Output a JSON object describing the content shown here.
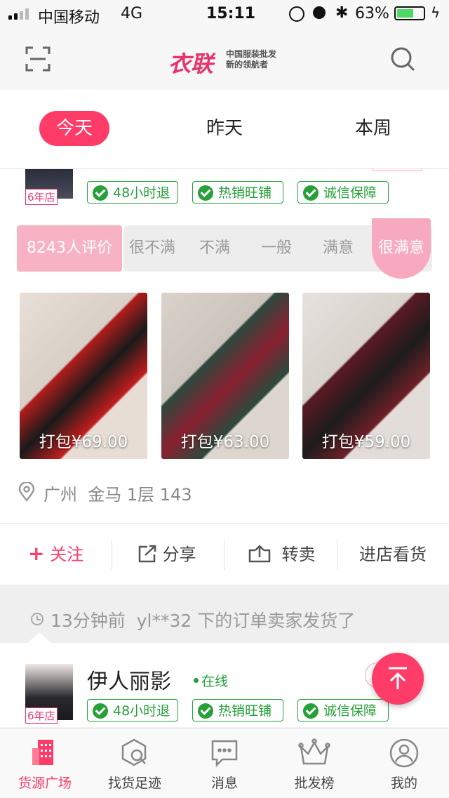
{
  "status_bar": {
    "carrier": "中国移动",
    "network": "4G",
    "time": "15:11",
    "battery": "63%",
    "battery_level": 0.63
  },
  "header": {
    "logo_main": "衣联",
    "logo_sub_line1": "中国服装批发",
    "logo_sub_line2": "新的领航者"
  },
  "tabs": [
    {
      "label": "今天",
      "active": true
    },
    {
      "label": "昨天",
      "active": false
    },
    {
      "label": "本周",
      "active": false
    }
  ],
  "shop1": {
    "years": "6年店",
    "badges": [
      "48小时退",
      "热销旺铺",
      "诚信保障"
    ],
    "reviews": "8243人评价",
    "ratings": [
      "很不满",
      "不满",
      "一般",
      "满意",
      "很满意"
    ],
    "products": [
      {
        "price": "打包¥69.00"
      },
      {
        "price": "打包¥63.00"
      },
      {
        "price": "打包¥59.00"
      }
    ],
    "location": "广州  金马 1层 143",
    "actions": {
      "follow": "关注",
      "share": "分享",
      "resell": "转卖",
      "visit": "进店看货"
    }
  },
  "notice": {
    "text": "13分钟前  yl**32 下的订单卖家发货了"
  },
  "shop2": {
    "name": "伊人丽影",
    "status": "在线",
    "years": "6年店",
    "badges": [
      "48小时退",
      "热销旺铺",
      "诚信保障"
    ]
  },
  "bottom_nav": [
    {
      "label": "货源广场",
      "icon": "building-icon",
      "active": true
    },
    {
      "label": "找货足迹",
      "icon": "footprint-search-icon",
      "active": false
    },
    {
      "label": "消息",
      "icon": "chat-icon",
      "active": false
    },
    {
      "label": "批发榜",
      "icon": "crown-icon",
      "active": false
    },
    {
      "label": "我的",
      "icon": "user-icon",
      "active": false
    }
  ],
  "colors": {
    "accent": "#ff3b68",
    "badge_green": "#27a03a"
  }
}
